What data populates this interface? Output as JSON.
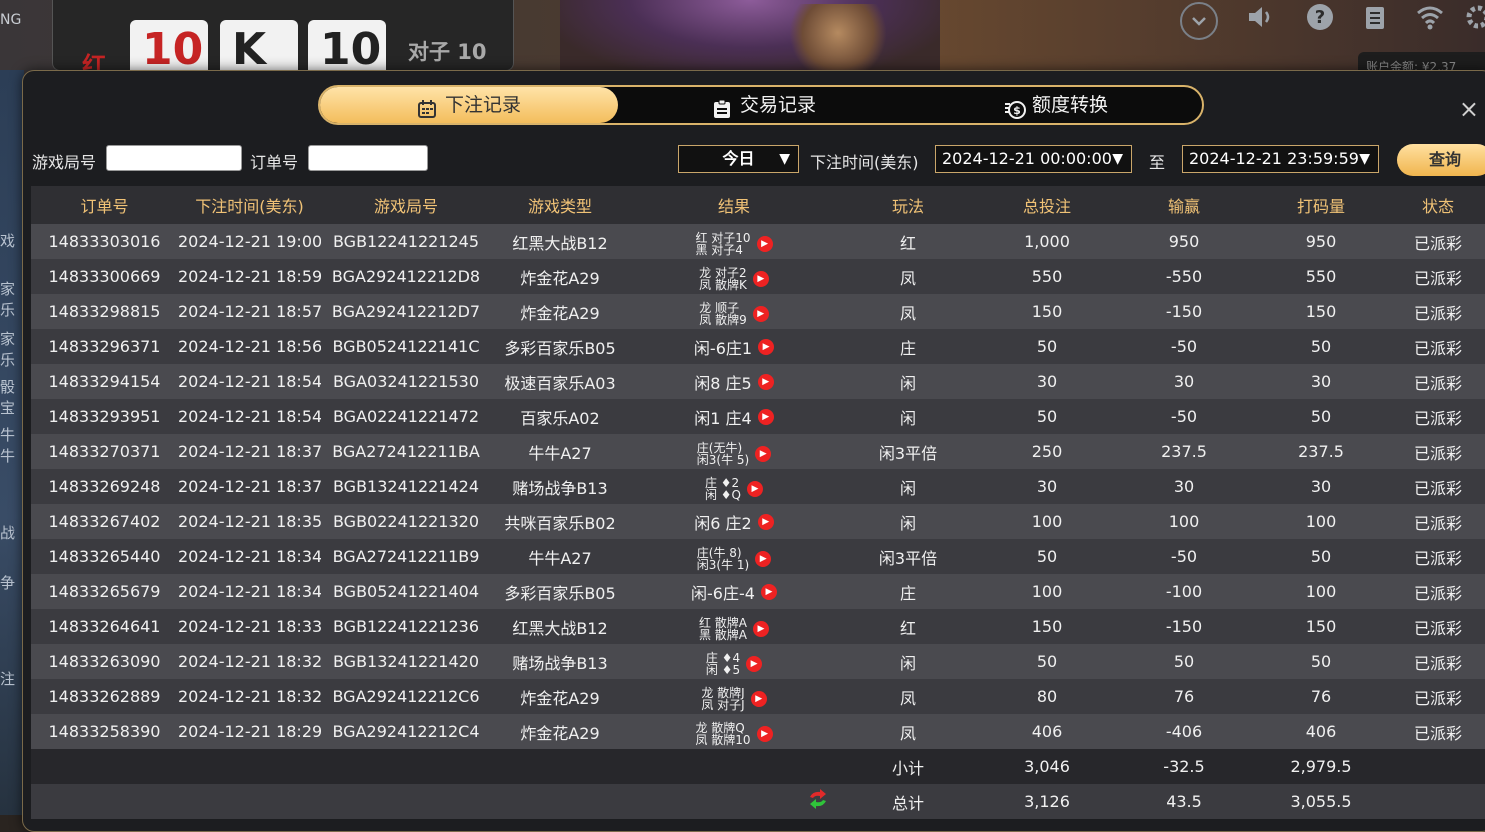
{
  "background": {
    "brand_fragment": "NG",
    "cards": {
      "red_label": "红",
      "values": [
        "10",
        "K",
        "10"
      ],
      "pair_label": "对子 10"
    },
    "left_labels": [
      "戏",
      "家乐",
      "家乐",
      "骰宝",
      "牛牛",
      "战",
      "争",
      "注"
    ],
    "balance_fragment": "账户余额: ¥2,37",
    "icons": [
      "chevron-down-icon",
      "volume-icon",
      "help-icon",
      "document-icon",
      "wifi-icon",
      "settings-icon"
    ]
  },
  "tabs": [
    {
      "label": "下注记录",
      "icon": "calendar-icon",
      "active": true
    },
    {
      "label": "交易记录",
      "icon": "clipboard-icon",
      "active": false
    },
    {
      "label": "额度转换",
      "icon": "coins-icon",
      "active": false
    }
  ],
  "close_icon": "×",
  "filter": {
    "game_round_label": "游戏局号",
    "game_round_value": "",
    "order_label": "订单号",
    "order_value": "",
    "range_select": "今日",
    "time_label": "下注时间(美东)",
    "start_time": "2024-12-21 00:00:00",
    "to_label": "至",
    "end_time": "2024-12-21 23:59:59",
    "query_label": "查询"
  },
  "columns": [
    "订单号",
    "下注时间(美东)",
    "游戏局号",
    "游戏类型",
    "结果",
    "玩法",
    "总投注",
    "输赢",
    "打码量",
    "状态"
  ],
  "rows": [
    {
      "order": "14833303016",
      "time": "2024-12-21 19:00",
      "round": "BGB12241221245",
      "game": "红黑大战B12",
      "result": [
        "红 对子10",
        "黑 对子4"
      ],
      "play": "红",
      "bet": "1,000",
      "winloss": "950",
      "wl_type": "win",
      "turnover": "950",
      "status": "已派彩"
    },
    {
      "order": "14833300669",
      "time": "2024-12-21 18:59",
      "round": "BGA292412212D8",
      "game": "炸金花A29",
      "result": [
        "龙 对子2",
        "凤 散牌K"
      ],
      "play": "凤",
      "bet": "550",
      "winloss": "-550",
      "wl_type": "lose",
      "turnover": "550",
      "status": "已派彩"
    },
    {
      "order": "14833298815",
      "time": "2024-12-21 18:57",
      "round": "BGA292412212D7",
      "game": "炸金花A29",
      "result": [
        "龙 顺子",
        "凤 散牌9"
      ],
      "play": "凤",
      "bet": "150",
      "winloss": "-150",
      "wl_type": "lose",
      "turnover": "150",
      "status": "已派彩"
    },
    {
      "order": "14833296371",
      "time": "2024-12-21 18:56",
      "round": "BGB0524122141C",
      "game": "多彩百家乐B05",
      "result": [
        "闲-6庄1"
      ],
      "play": "庄",
      "bet": "50",
      "winloss": "-50",
      "wl_type": "lose",
      "turnover": "50",
      "status": "已派彩"
    },
    {
      "order": "14833294154",
      "time": "2024-12-21 18:54",
      "round": "BGA03241221530",
      "game": "极速百家乐A03",
      "result": [
        "闲8 庄5"
      ],
      "play": "闲",
      "bet": "30",
      "winloss": "30",
      "wl_type": "win",
      "turnover": "30",
      "status": "已派彩"
    },
    {
      "order": "14833293951",
      "time": "2024-12-21 18:54",
      "round": "BGA02241221472",
      "game": "百家乐A02",
      "result": [
        "闲1 庄4"
      ],
      "play": "闲",
      "bet": "50",
      "winloss": "-50",
      "wl_type": "lose",
      "turnover": "50",
      "status": "已派彩"
    },
    {
      "order": "14833270371",
      "time": "2024-12-21 18:37",
      "round": "BGA272412211BA",
      "game": "牛牛A27",
      "result": [
        "庄(无牛)",
        "闲3(牛 5)"
      ],
      "play": "闲3平倍",
      "bet": "250",
      "winloss": "237.5",
      "wl_type": "win",
      "turnover": "237.5",
      "status": "已派彩"
    },
    {
      "order": "14833269248",
      "time": "2024-12-21 18:37",
      "round": "BGB13241221424",
      "game": "赌场战争B13",
      "result": [
        "庄 ♦2",
        "闲 ♦Q"
      ],
      "play": "闲",
      "bet": "30",
      "winloss": "30",
      "wl_type": "win",
      "turnover": "30",
      "status": "已派彩"
    },
    {
      "order": "14833267402",
      "time": "2024-12-21 18:35",
      "round": "BGB02241221320",
      "game": "共咪百家乐B02",
      "result": [
        "闲6 庄2"
      ],
      "play": "闲",
      "bet": "100",
      "winloss": "100",
      "wl_type": "win",
      "turnover": "100",
      "status": "已派彩"
    },
    {
      "order": "14833265440",
      "time": "2024-12-21 18:34",
      "round": "BGA272412211B9",
      "game": "牛牛A27",
      "result": [
        "庄(牛 8)",
        "闲3(牛 1)"
      ],
      "play": "闲3平倍",
      "bet": "50",
      "winloss": "-50",
      "wl_type": "lose",
      "turnover": "50",
      "status": "已派彩"
    },
    {
      "order": "14833265679",
      "time": "2024-12-21 18:34",
      "round": "BGB05241221404",
      "game": "多彩百家乐B05",
      "result": [
        "闲-6庄-4"
      ],
      "play": "庄",
      "bet": "100",
      "winloss": "-100",
      "wl_type": "lose",
      "turnover": "100",
      "status": "已派彩"
    },
    {
      "order": "14833264641",
      "time": "2024-12-21 18:33",
      "round": "BGB12241221236",
      "game": "红黑大战B12",
      "result": [
        "红 散牌A",
        "黑 散牌A"
      ],
      "play": "红",
      "bet": "150",
      "winloss": "-150",
      "wl_type": "lose",
      "turnover": "150",
      "status": "已派彩"
    },
    {
      "order": "14833263090",
      "time": "2024-12-21 18:32",
      "round": "BGB13241221420",
      "game": "赌场战争B13",
      "result": [
        "庄 ♦4",
        "闲 ♦5"
      ],
      "play": "闲",
      "bet": "50",
      "winloss": "50",
      "wl_type": "win",
      "turnover": "50",
      "status": "已派彩"
    },
    {
      "order": "14833262889",
      "time": "2024-12-21 18:32",
      "round": "BGA292412212C6",
      "game": "炸金花A29",
      "result": [
        "龙 散牌J",
        "凤 对子J"
      ],
      "play": "凤",
      "bet": "80",
      "winloss": "76",
      "wl_type": "win",
      "turnover": "76",
      "status": "已派彩"
    },
    {
      "order": "14833258390",
      "time": "2024-12-21 18:29",
      "round": "BGA292412212C4",
      "game": "炸金花A29",
      "result": [
        "龙 散牌Q",
        "凤 散牌10"
      ],
      "play": "凤",
      "bet": "406",
      "winloss": "-406",
      "wl_type": "lose",
      "turnover": "406",
      "status": "已派彩"
    }
  ],
  "subtotal": {
    "label": "小计",
    "bet": "3,046",
    "winloss": "-32.5",
    "wl_type": "lose",
    "turnover": "2,979.5"
  },
  "total": {
    "label": "总计",
    "bet": "3,126",
    "winloss": "43.5",
    "wl_type": "win",
    "turnover": "3,055.5"
  },
  "colors": {
    "accent_gold": "#f0c276",
    "win_red": "#e12a2a",
    "lose_green": "#2fd43a"
  }
}
